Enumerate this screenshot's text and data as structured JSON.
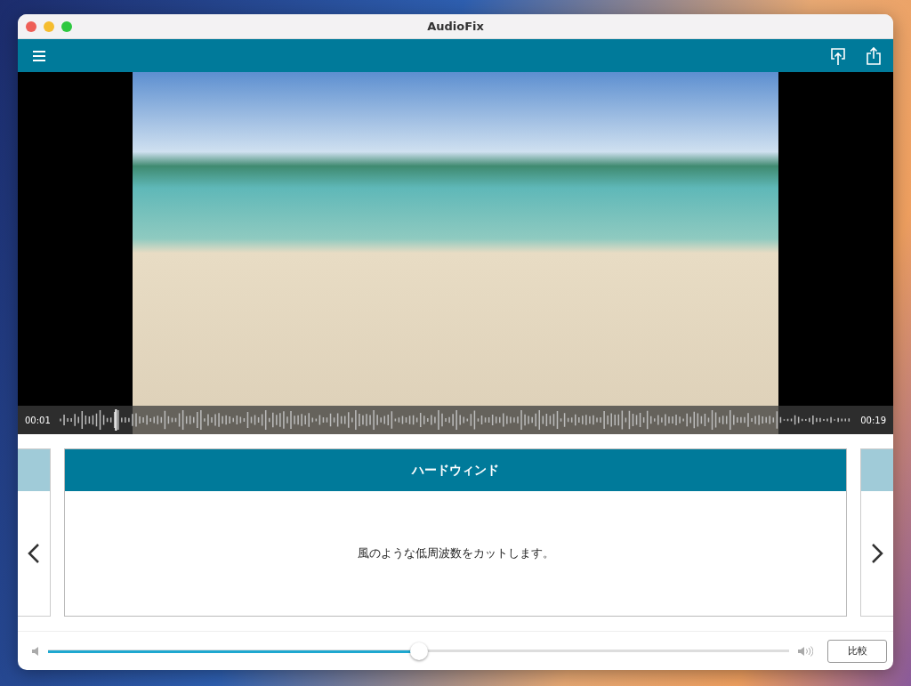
{
  "window": {
    "title": "AudioFix"
  },
  "playback": {
    "start_time": "00:01",
    "end_time": "00:19",
    "level": 0.07
  },
  "effect_card": {
    "title": "ハードウィンド",
    "description": "風のような低周波数をカットします。"
  },
  "mix_slider": {
    "level": 0.5
  },
  "compare_button": {
    "label": "比較"
  }
}
